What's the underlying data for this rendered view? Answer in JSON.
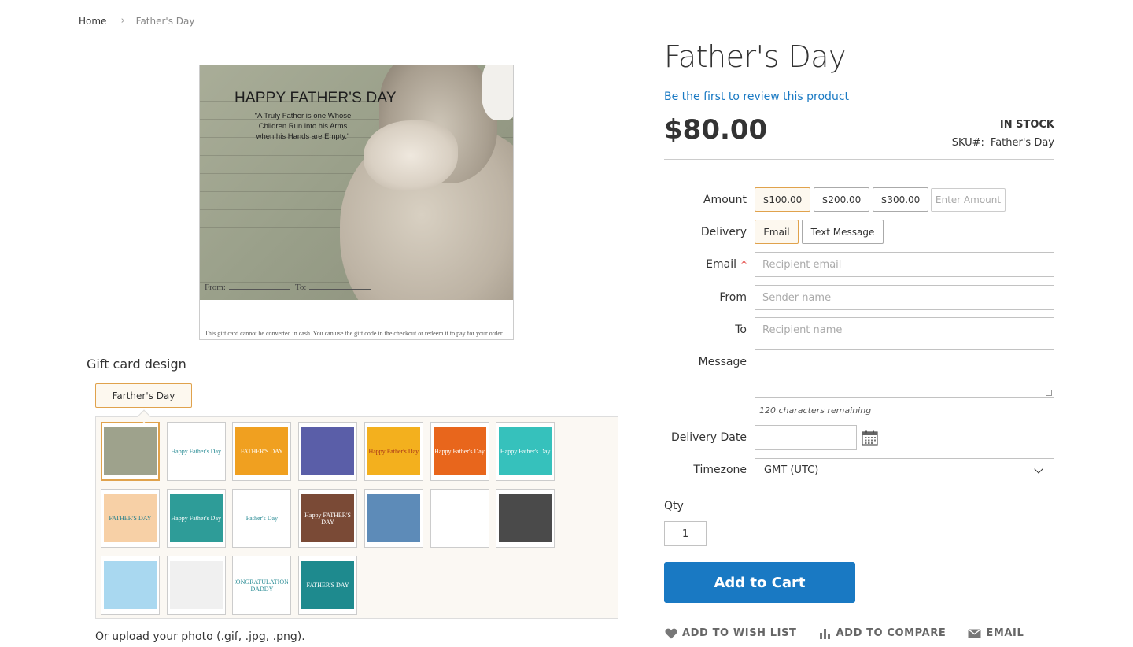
{
  "breadcrumb": {
    "home": "Home",
    "separator": "›",
    "current": "Father's Day"
  },
  "preview": {
    "title": "HAPPY FATHER'S DAY",
    "quote": "\"A Truly Father is one Whose Children Run into his Arms when his Hands are Empty.\"",
    "from_label": "From:",
    "to_label": "To:",
    "footer": "This gift card cannot be converted in cash. You can use the gift code in the checkout or redeem it to pay for your order"
  },
  "design": {
    "heading": "Gift card design",
    "tab_label": "Farther's Day",
    "thumbnails": [
      {
        "label": "",
        "color": "#9ea28c",
        "selected": true
      },
      {
        "label": "Happy Father's Day",
        "color": "#ffffff",
        "text_color": "#2a8c95"
      },
      {
        "label": "FATHER'S DAY",
        "color": "#f0a020"
      },
      {
        "label": "",
        "color": "#5a5ea8"
      },
      {
        "label": "Happy Father's Day",
        "color": "#f3b01e",
        "text_color": "#a8341a"
      },
      {
        "label": "Happy Father's Day",
        "color": "#e8661c"
      },
      {
        "label": "Happy Father's Day",
        "color": "#36c1bc"
      },
      {
        "label": "FATHER'S DAY",
        "color": "#f7d0a6",
        "text_color": "#247f8c"
      },
      {
        "label": "Happy Father's Day",
        "color": "#2e9c98"
      },
      {
        "label": "Father's Day",
        "color": "#ffffff",
        "text_color": "#2a8c95"
      },
      {
        "label": "Happy FATHER'S DAY",
        "color": "#7a4a36"
      },
      {
        "label": "",
        "color": "#5d8bb8"
      },
      {
        "label": "",
        "color": "#ffffff",
        "text_color": "#48a6a0"
      },
      {
        "label": "",
        "color": "#4a4a4a"
      },
      {
        "label": "",
        "color": "#a9d8f0"
      },
      {
        "label": "",
        "color": "#f0f0f0"
      },
      {
        "label": "CONGRATULATIONS DADDY",
        "color": "#ffffff",
        "text_color": "#2a8c95"
      },
      {
        "label": "FATHER'S DAY",
        "color": "#1e8a8e"
      }
    ]
  },
  "upload_text": "Or upload your photo (.gif, .jpg, .png).",
  "product": {
    "title": "Father's Day",
    "review_link": "Be the first to review this product",
    "price": "$80.00",
    "stock": "IN STOCK",
    "sku_label": "SKU#:",
    "sku_value": "Father's Day"
  },
  "form": {
    "amount_label": "Amount",
    "amounts": [
      "$100.00",
      "$200.00",
      "$300.00"
    ],
    "amount_placeholder": "Enter Amount",
    "delivery_label": "Delivery",
    "delivery_options": [
      "Email",
      "Text Message"
    ],
    "email_label": "Email",
    "email_required": "*",
    "email_placeholder": "Recipient email",
    "from_label": "From",
    "from_placeholder": "Sender name",
    "to_label": "To",
    "to_placeholder": "Recipient name",
    "message_label": "Message",
    "chars_remaining": "120 characters remaining",
    "delivery_date_label": "Delivery Date",
    "timezone_label": "Timezone",
    "timezone_value": "GMT (UTC)",
    "qty_label": "Qty",
    "qty_value": "1",
    "add_to_cart": "Add to Cart"
  },
  "actions": {
    "wishlist": "ADD TO WISH LIST",
    "compare": "ADD TO COMPARE",
    "email": "EMAIL"
  },
  "colors": {
    "accent": "#1979c3",
    "selected_border": "#e0a24c",
    "required": "#e02b27"
  }
}
